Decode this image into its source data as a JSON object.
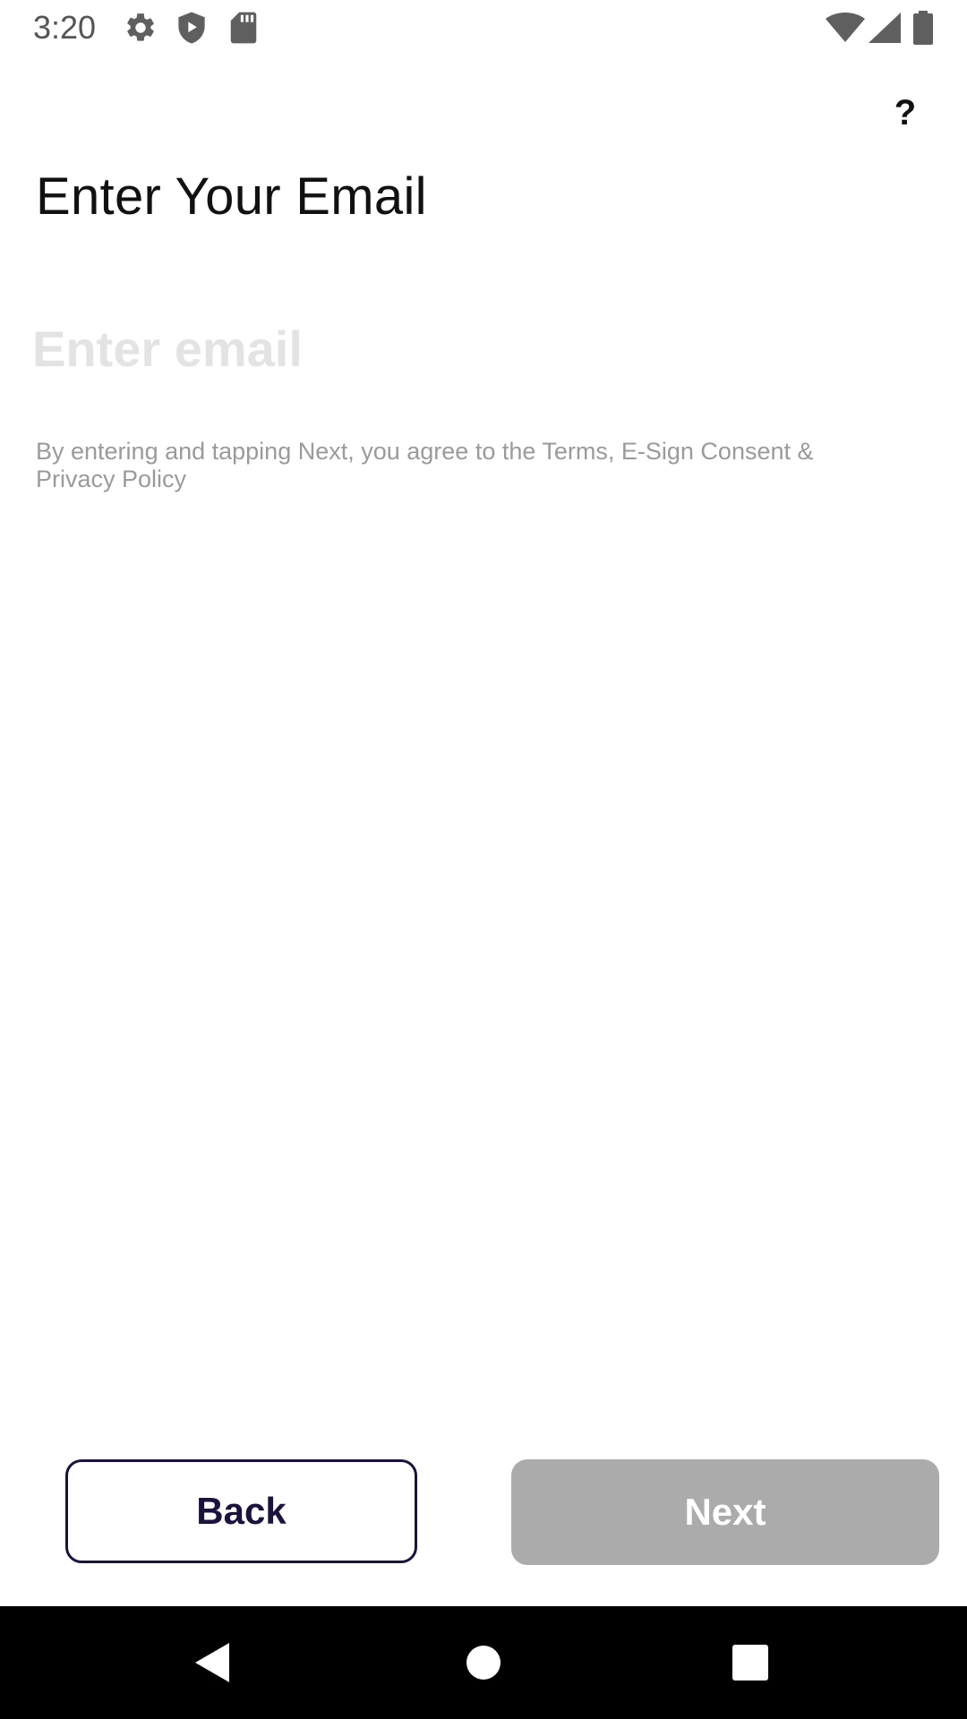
{
  "status_bar": {
    "time": "3:20",
    "left_icons": [
      "gear-icon",
      "shield-play-icon",
      "sd-card-icon"
    ],
    "right_icons": [
      "wifi-icon",
      "cell-signal-icon",
      "battery-icon"
    ]
  },
  "header": {
    "help_label": "?"
  },
  "main": {
    "title": "Enter Your Email",
    "email_input": {
      "value": "",
      "placeholder": "Enter email"
    },
    "consent_text": "By entering and tapping Next, you agree to the Terms, E-Sign Consent & Privacy Policy"
  },
  "footer": {
    "back_label": "Back",
    "next_label": "Next"
  },
  "nav_bar": {
    "icons": [
      "back-triangle-icon",
      "home-circle-icon",
      "recents-square-icon"
    ]
  },
  "colors": {
    "primary_dark": "#1d1140",
    "disabled_button": "#ababab",
    "placeholder": "#e3e3e3",
    "secondary_text": "#9a9a9a"
  }
}
